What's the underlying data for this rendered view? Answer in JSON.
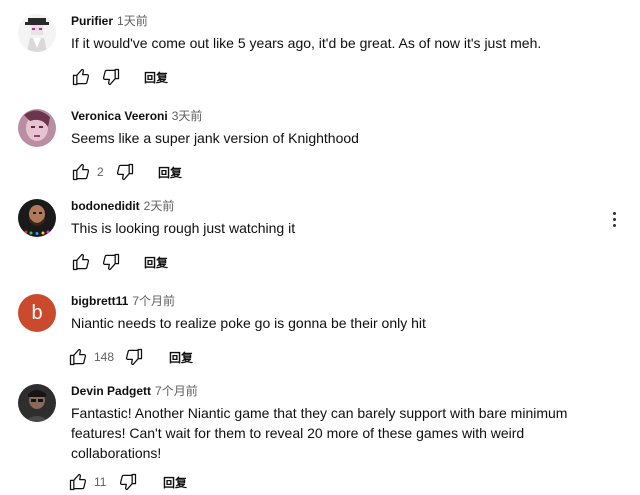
{
  "comments": [
    {
      "author": "Purifier",
      "time": "1天前",
      "text": "If it would've come out like 5 years ago, it'd be great. As of now it's just meh.",
      "likes": "",
      "reply": "回复",
      "avatar": "dark-hat-figure"
    },
    {
      "author": "Veronica Veeroni",
      "time": "3天前",
      "text": "Seems like a super jank version of Knighthood",
      "likes": "2",
      "reply": "回复",
      "avatar": "purple-portrait"
    },
    {
      "author": "bodonedidit",
      "time": "2天前",
      "text": "This is looking rough just watching it",
      "likes": "",
      "reply": "回复",
      "avatar": "bearded-man"
    },
    {
      "author": "bigbrett11",
      "time": "7个月前",
      "text": "Niantic needs to realize poke go is gonna be their only hit",
      "likes": "148",
      "reply": "回复",
      "avatar": "letter-b",
      "avatar_letter": "b",
      "avatar_color": "#c94a2c"
    },
    {
      "author": "Devin Padgett",
      "time": "7个月前",
      "text": "Fantastic! Another Niantic game that they can barely support with bare minimum features! Can't wait for them to reveal 20 more of these games with weird collaborations!",
      "likes": "11",
      "reply": "回复",
      "avatar": "dark-portrait"
    }
  ],
  "icons": {
    "like": "thumb-up-icon",
    "dislike": "thumb-down-icon",
    "menu": "more-vert-icon"
  }
}
